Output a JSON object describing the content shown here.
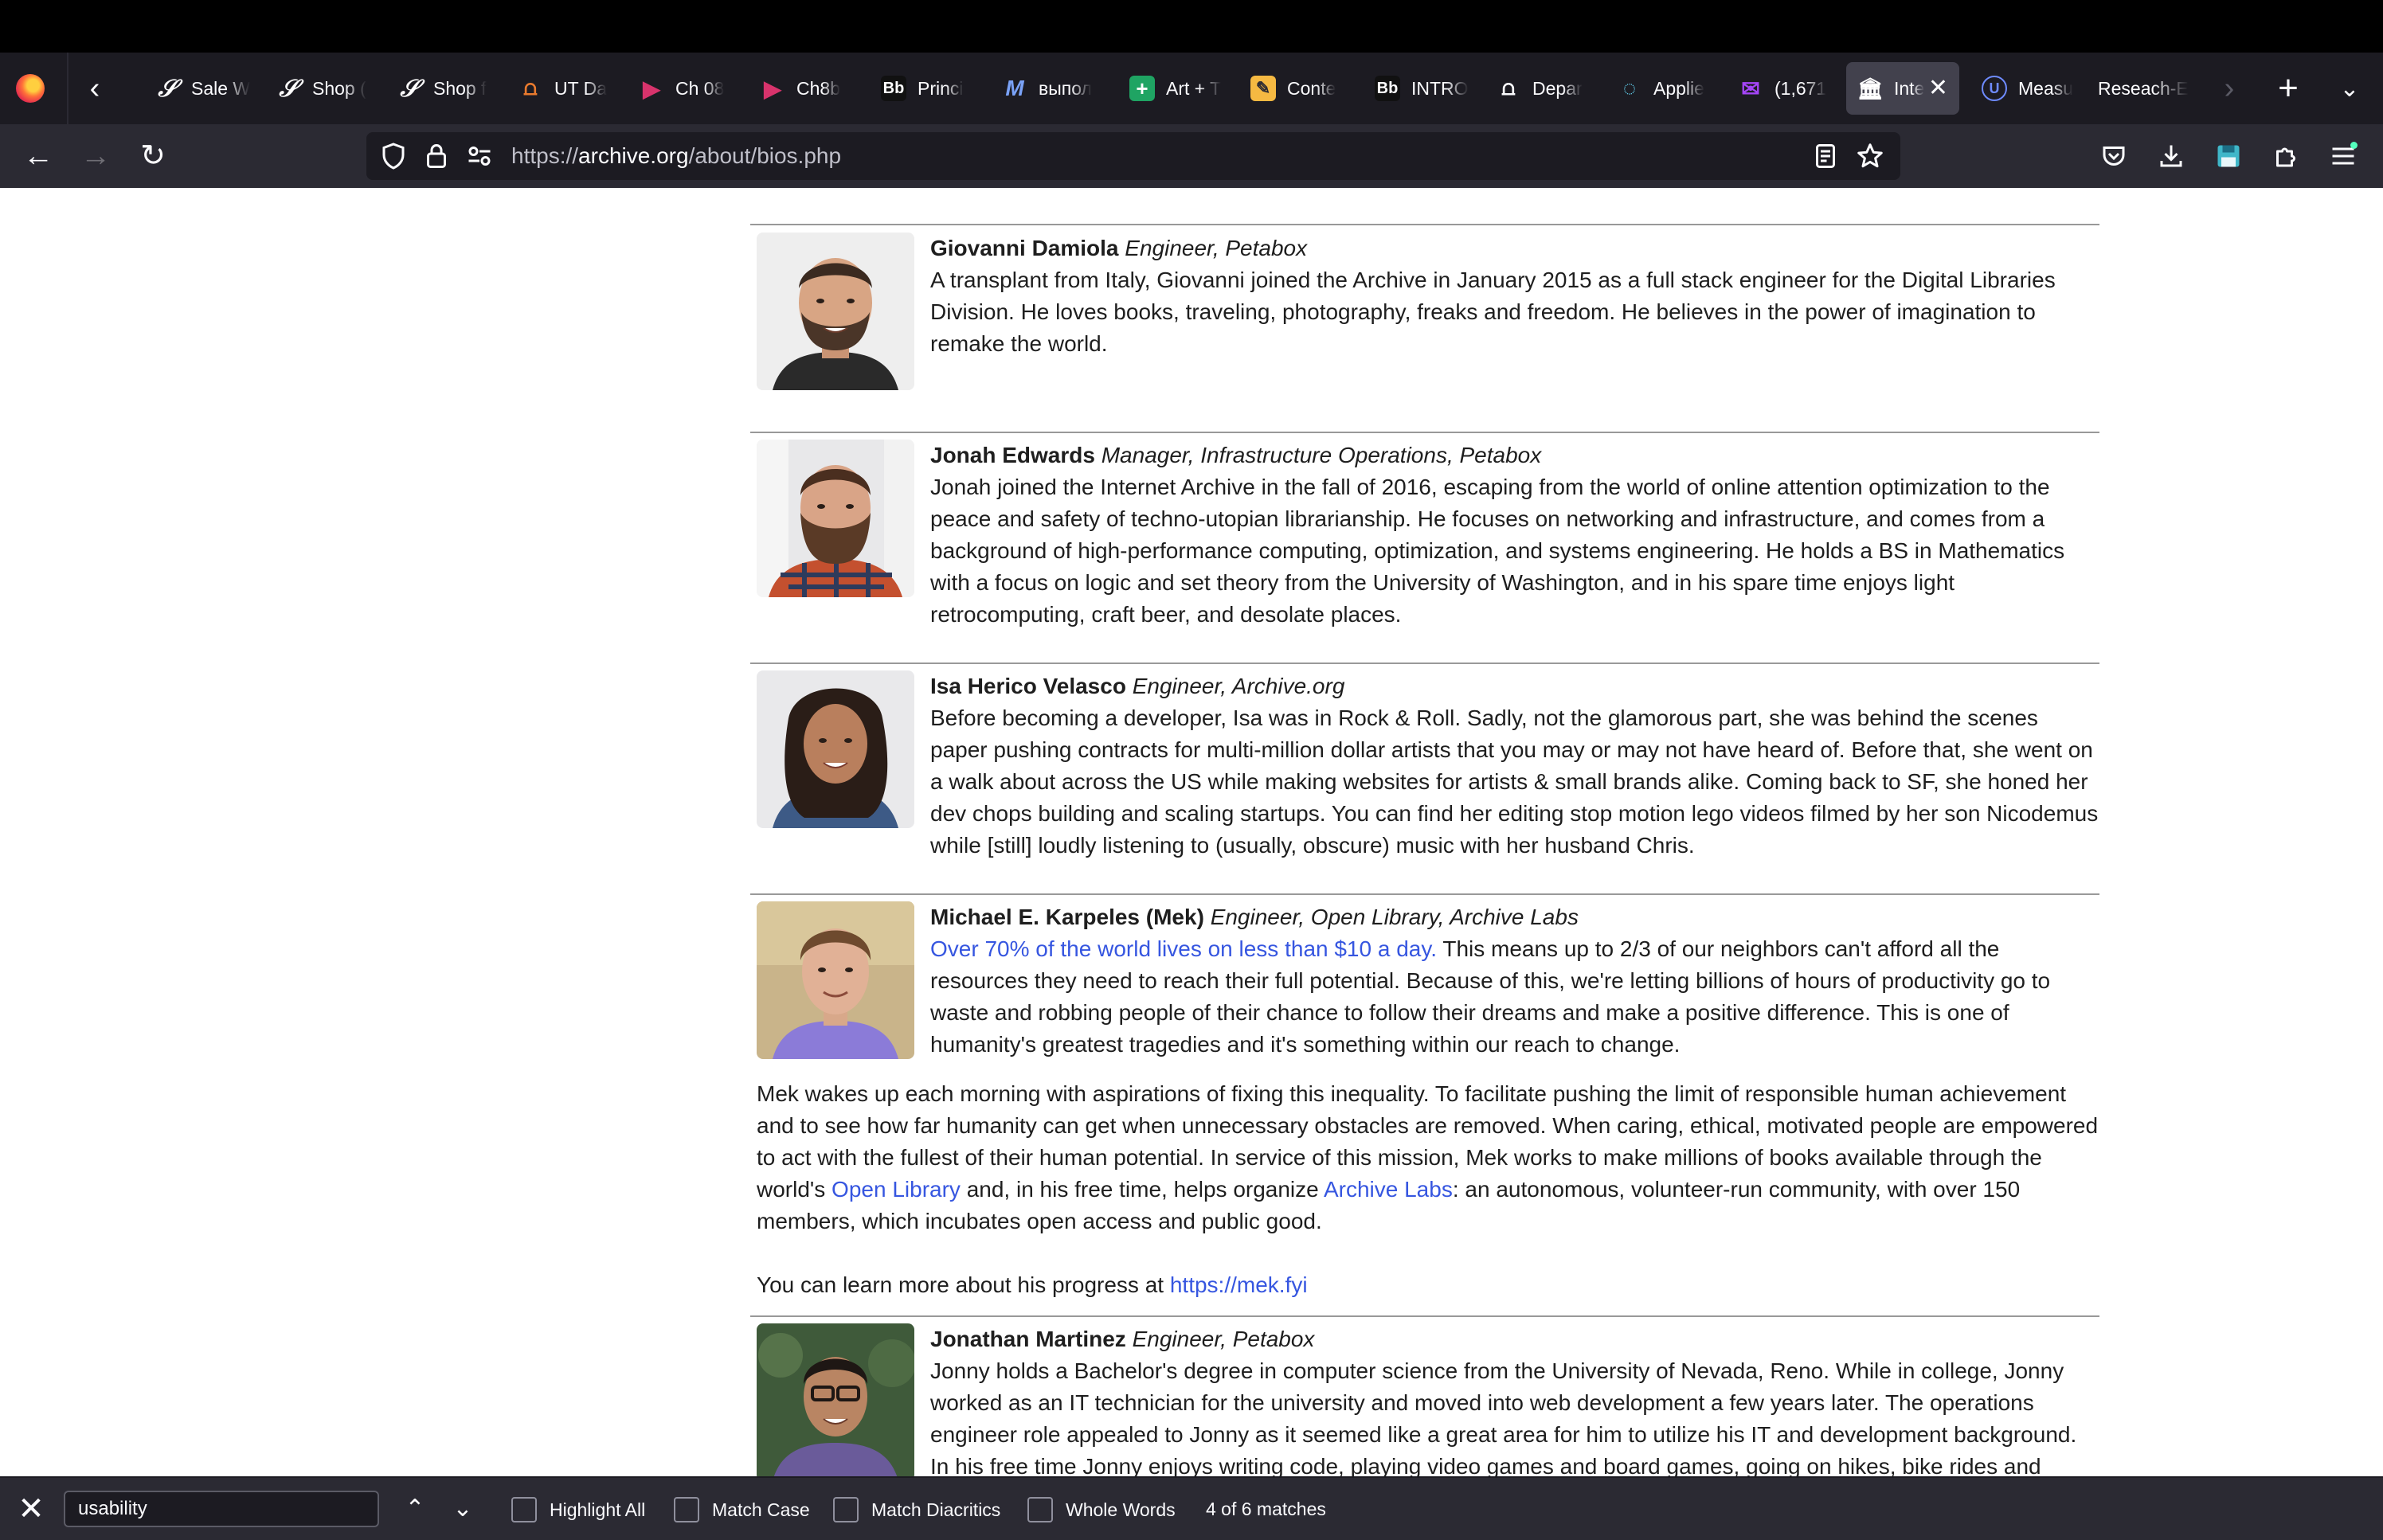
{
  "browser": {
    "tabs": [
      {
        "label": "Sale W",
        "icon": "script-s-icon",
        "active": false
      },
      {
        "label": "Shop (",
        "icon": "script-s-icon",
        "active": false
      },
      {
        "label": "Shop f",
        "icon": "script-s-icon",
        "active": false
      },
      {
        "label": "UT Da",
        "icon": "ut-tower-icon",
        "active": false
      },
      {
        "label": "Ch 08",
        "icon": "play-icon",
        "active": false
      },
      {
        "label": "Ch8b",
        "icon": "play-icon",
        "active": false
      },
      {
        "label": "Princi",
        "icon": "blackboard-icon",
        "active": false
      },
      {
        "label": "выпол",
        "icon": "m-logo-icon",
        "active": false
      },
      {
        "label": "Art + T",
        "icon": "google-sheets-icon",
        "active": false
      },
      {
        "label": "Conte",
        "icon": "notes-icon",
        "active": false
      },
      {
        "label": "INTRO",
        "icon": "blackboard-icon",
        "active": false
      },
      {
        "label": "Depar",
        "icon": "ut-tower-icon",
        "active": false
      },
      {
        "label": "Applie",
        "icon": "loading-icon",
        "active": false
      },
      {
        "label": "(1,671",
        "icon": "mail-icon",
        "active": false
      },
      {
        "label": "Inte",
        "icon": "archive-icon",
        "active": true
      },
      {
        "label": "Measu",
        "icon": "u-logo-icon",
        "active": false
      },
      {
        "label": "Reseach-E",
        "icon": "",
        "active": false
      }
    ],
    "url_prefix": "https://",
    "url_domain": "archive.org",
    "url_path": "/about/bios.php"
  },
  "bios": [
    {
      "name": "Giovanni Damiola",
      "role": "Engineer, Petabox",
      "text": "A transplant from Italy, Giovanni joined the Archive in January 2015 as a full stack engineer for the Digital Libraries Division. He loves books, traveling, photography, freaks and freedom. He believes in the power of imagination to remake the world."
    },
    {
      "name": "Jonah Edwards",
      "role": "Manager, Infrastructure Operations, Petabox",
      "text": "Jonah joined the Internet Archive in the fall of 2016, escaping from the world of online attention optimization to the peace and safety of techno-utopian librarianship. He focuses on networking and infrastructure, and comes from a background of high-performance computing, optimization, and systems engineering. He holds a BS in Mathematics with a focus on logic and set theory from the University of Washington, and in his spare time enjoys light retrocomputing, craft beer, and desolate places."
    },
    {
      "name": "Isa Herico Velasco",
      "role": "Engineer, Archive.org",
      "text": "Before becoming a developer, Isa was in Rock & Roll. Sadly, not the glamorous part, she was behind the scenes paper pushing contracts for multi-million dollar artists that you may or may not have heard of. Before that, she went on a walk about across the US while making websites for artists & small brands alike. Coming back to SF, she honed her dev chops building and scaling startups. You can find her editing stop motion lego videos filmed by her son Nicodemus while [still] loudly listening to (usually, obscure) music with her husband Chris."
    },
    {
      "name": "Michael E. Karpeles (Mek)",
      "role": "Engineer, Open Library, Archive Labs",
      "link1": "Over 70% of the world lives on less than $10 a day.",
      "text": " This means up to 2/3 of our neighbors can't afford all the resources they need to reach their full potential. Because of this, we're letting billions of hours of productivity go to waste and robbing people of their chance to follow their dreams and make a positive difference. This is one of humanity's greatest tragedies and it's something within our reach to change.",
      "para2_a": "Mek wakes up each morning with aspirations of fixing this inequality. To facilitate pushing the limit of responsible human achievement and to see how far humanity can get when unnecessary obstacles are removed. When caring, ethical, motivated people are empowered to act with the fullest of their human potential. In service of this mission, Mek works to make millions of books available through the world's ",
      "para2_link1": "Open Library",
      "para2_b": " and, in his free time, helps organize ",
      "para2_link2": "Archive Labs",
      "para2_c": ": an autonomous, volunteer-run community, with over 150 members, which incubates open access and public good.",
      "para3": "You can learn more about his progress at ",
      "para3_link": "https://mek.fyi"
    },
    {
      "name": "Jonathan Martinez",
      "role": "Engineer, Petabox",
      "text": "Jonny holds a Bachelor's degree in computer science from the University of Nevada, Reno. While in college, Jonny worked as an IT technician for the university and moved into web development a few years later. The operations engineer role appealed to Jonny as it seemed like a great area for him to utilize his IT and development background. In his free time Jonny enjoys writing code, playing video games and board games, going on hikes, bike rides and"
    }
  ],
  "findbar": {
    "query": "usability",
    "options": [
      "Highlight All",
      "Match Case",
      "Match Diacritics",
      "Whole Words"
    ],
    "status": "4 of 6 matches"
  },
  "colors": {
    "link": "#3656e0",
    "toolbar": "#2b2a33",
    "tabstrip": "#1c1b22"
  }
}
